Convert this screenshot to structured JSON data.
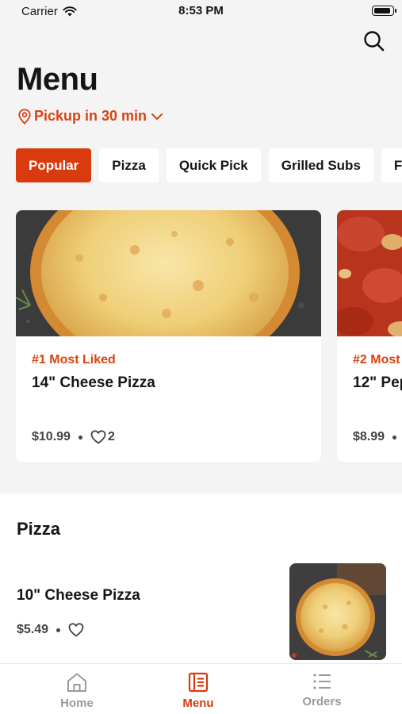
{
  "status_bar": {
    "carrier": "Carrier",
    "time": "8:53 PM"
  },
  "header": {
    "title": "Menu",
    "pickup": "Pickup in 30 min"
  },
  "chips": [
    "Popular",
    "Pizza",
    "Quick Pick",
    "Grilled Subs",
    "F"
  ],
  "featured": [
    {
      "badge": "#1 Most Liked",
      "name": "14\" Cheese Pizza",
      "price": "$10.99",
      "likes": "2"
    },
    {
      "badge": "#2 Most",
      "name": "12\" Pep",
      "price": "$8.99",
      "likes": ""
    }
  ],
  "section": {
    "title": "Pizza",
    "items": [
      {
        "name": "10\" Cheese Pizza",
        "price": "$5.49"
      }
    ]
  },
  "tabbar": {
    "home": "Home",
    "menu": "Menu",
    "orders": "Orders"
  },
  "colors": {
    "accent": "#d93a0e",
    "accent_text": "#d94313",
    "inactive": "#9a9a9a"
  },
  "icons": [
    "wifi-icon",
    "battery-icon",
    "search-icon",
    "location-pin-icon",
    "chevron-down-icon",
    "heart-icon",
    "home-icon",
    "menu-icon",
    "orders-list-icon"
  ]
}
